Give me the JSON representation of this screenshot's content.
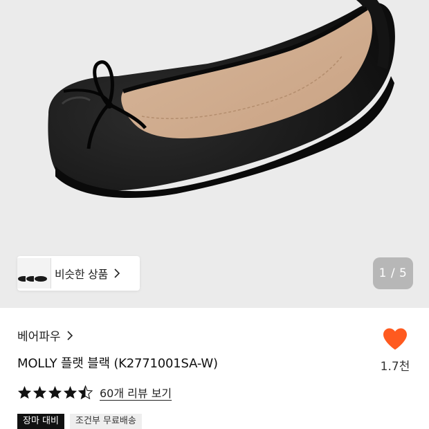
{
  "gallery": {
    "similar_label": "비슷한 상품",
    "counter": "1 / 5"
  },
  "product": {
    "brand": "베어파우",
    "name": "MOLLY 플랫 블랙 (K2771001SA-W)",
    "like_count": "1.7천",
    "rating": 4.5,
    "review_link": "60개 리뷰 보기",
    "badges": [
      "장마 대비",
      "조건부 무료배송"
    ]
  },
  "colors": {
    "gallery_bg": "#ebebeb",
    "heart": "#ff5a1f",
    "star": "#111111"
  },
  "icons": [
    "chevron-right-icon",
    "heart-icon",
    "star-icon"
  ]
}
